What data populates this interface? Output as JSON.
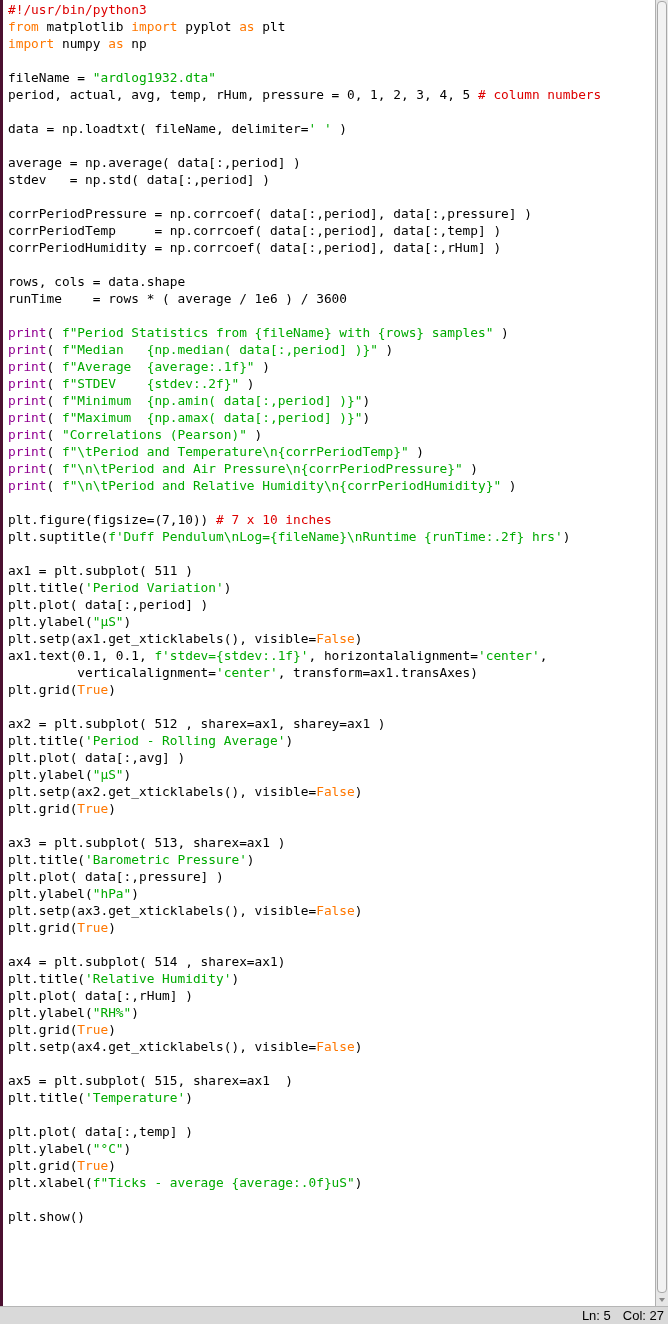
{
  "editor": {
    "lines": [
      {
        "kind": "code",
        "tokens": [
          {
            "kind": "comment",
            "text": "#!/usr/bin/python3"
          }
        ]
      },
      {
        "kind": "code",
        "tokens": [
          {
            "kind": "keyword",
            "text": "from"
          },
          {
            "kind": "plain",
            "text": " matplotlib "
          },
          {
            "kind": "keyword",
            "text": "import"
          },
          {
            "kind": "plain",
            "text": " pyplot "
          },
          {
            "kind": "keyword",
            "text": "as"
          },
          {
            "kind": "plain",
            "text": " plt"
          }
        ]
      },
      {
        "kind": "code",
        "tokens": [
          {
            "kind": "keyword",
            "text": "import"
          },
          {
            "kind": "plain",
            "text": " numpy "
          },
          {
            "kind": "keyword",
            "text": "as"
          },
          {
            "kind": "plain",
            "text": " np"
          }
        ]
      },
      {
        "kind": "blank"
      },
      {
        "kind": "code",
        "tokens": [
          {
            "kind": "plain",
            "text": "fileName = "
          },
          {
            "kind": "string",
            "text": "\"ardlog1932.dta\""
          }
        ]
      },
      {
        "kind": "code",
        "tokens": [
          {
            "kind": "plain",
            "text": "period, actual, avg, temp, rHum, pressure = 0, 1, 2, 3, 4, 5 "
          },
          {
            "kind": "comment",
            "text": "# column numbers"
          }
        ]
      },
      {
        "kind": "blank"
      },
      {
        "kind": "code",
        "tokens": [
          {
            "kind": "plain",
            "text": "data = np.loadtxt( fileName, delimiter="
          },
          {
            "kind": "string",
            "text": "' '"
          },
          {
            "kind": "plain",
            "text": " )"
          }
        ]
      },
      {
        "kind": "blank"
      },
      {
        "kind": "code",
        "tokens": [
          {
            "kind": "plain",
            "text": "average = np.average( data[:,period] )"
          }
        ]
      },
      {
        "kind": "code",
        "tokens": [
          {
            "kind": "plain",
            "text": "stdev   = np.std( data[:,period] )"
          }
        ]
      },
      {
        "kind": "blank"
      },
      {
        "kind": "code",
        "tokens": [
          {
            "kind": "plain",
            "text": "corrPeriodPressure = np.corrcoef( data[:,period], data[:,pressure] )"
          }
        ]
      },
      {
        "kind": "code",
        "tokens": [
          {
            "kind": "plain",
            "text": "corrPeriodTemp     = np.corrcoef( data[:,period], data[:,temp] )"
          }
        ]
      },
      {
        "kind": "code",
        "tokens": [
          {
            "kind": "plain",
            "text": "corrPeriodHumidity = np.corrcoef( data[:,period], data[:,rHum] )"
          }
        ]
      },
      {
        "kind": "blank"
      },
      {
        "kind": "code",
        "tokens": [
          {
            "kind": "plain",
            "text": "rows, cols = data.shape"
          }
        ]
      },
      {
        "kind": "code",
        "tokens": [
          {
            "kind": "plain",
            "text": "runTime    = rows * ( average / 1e6 ) / 3600"
          }
        ]
      },
      {
        "kind": "blank"
      },
      {
        "kind": "code",
        "tokens": [
          {
            "kind": "builtin",
            "text": "print"
          },
          {
            "kind": "plain",
            "text": "( "
          },
          {
            "kind": "string",
            "text": "f\"Period Statistics from {fileName} with {rows} samples\""
          },
          {
            "kind": "plain",
            "text": " )"
          }
        ]
      },
      {
        "kind": "code",
        "tokens": [
          {
            "kind": "builtin",
            "text": "print"
          },
          {
            "kind": "plain",
            "text": "( "
          },
          {
            "kind": "string",
            "text": "f\"Median   {np.median( data[:,period] )}\""
          },
          {
            "kind": "plain",
            "text": " )"
          }
        ]
      },
      {
        "kind": "code",
        "tokens": [
          {
            "kind": "builtin",
            "text": "print"
          },
          {
            "kind": "plain",
            "text": "( "
          },
          {
            "kind": "string",
            "text": "f\"Average  {average:.1f}\""
          },
          {
            "kind": "plain",
            "text": " )"
          }
        ]
      },
      {
        "kind": "code",
        "tokens": [
          {
            "kind": "builtin",
            "text": "print"
          },
          {
            "kind": "plain",
            "text": "( "
          },
          {
            "kind": "string",
            "text": "f\"STDEV    {stdev:.2f}\""
          },
          {
            "kind": "plain",
            "text": " )"
          }
        ]
      },
      {
        "kind": "code",
        "tokens": [
          {
            "kind": "builtin",
            "text": "print"
          },
          {
            "kind": "plain",
            "text": "( "
          },
          {
            "kind": "string",
            "text": "f\"Minimum  {np.amin( data[:,period] )}\""
          },
          {
            "kind": "plain",
            "text": ")"
          }
        ]
      },
      {
        "kind": "code",
        "tokens": [
          {
            "kind": "builtin",
            "text": "print"
          },
          {
            "kind": "plain",
            "text": "( "
          },
          {
            "kind": "string",
            "text": "f\"Maximum  {np.amax( data[:,period] )}\""
          },
          {
            "kind": "plain",
            "text": ")"
          }
        ]
      },
      {
        "kind": "code",
        "tokens": [
          {
            "kind": "builtin",
            "text": "print"
          },
          {
            "kind": "plain",
            "text": "( "
          },
          {
            "kind": "string",
            "text": "\"Correlations (Pearson)\""
          },
          {
            "kind": "plain",
            "text": " )"
          }
        ]
      },
      {
        "kind": "code",
        "tokens": [
          {
            "kind": "builtin",
            "text": "print"
          },
          {
            "kind": "plain",
            "text": "( "
          },
          {
            "kind": "string",
            "text": "f\"\\tPeriod and Temperature\\n{corrPeriodTemp}\""
          },
          {
            "kind": "plain",
            "text": " )"
          }
        ]
      },
      {
        "kind": "code",
        "tokens": [
          {
            "kind": "builtin",
            "text": "print"
          },
          {
            "kind": "plain",
            "text": "( "
          },
          {
            "kind": "string",
            "text": "f\"\\n\\tPeriod and Air Pressure\\n{corrPeriodPressure}\""
          },
          {
            "kind": "plain",
            "text": " )"
          }
        ]
      },
      {
        "kind": "code",
        "tokens": [
          {
            "kind": "builtin",
            "text": "print"
          },
          {
            "kind": "plain",
            "text": "( "
          },
          {
            "kind": "string",
            "text": "f\"\\n\\tPeriod and Relative Humidity\\n{corrPeriodHumidity}\""
          },
          {
            "kind": "plain",
            "text": " )"
          }
        ]
      },
      {
        "kind": "blank"
      },
      {
        "kind": "code",
        "tokens": [
          {
            "kind": "plain",
            "text": "plt.figure(figsize=(7,10)) "
          },
          {
            "kind": "comment",
            "text": "# 7 x 10 inches"
          }
        ]
      },
      {
        "kind": "code",
        "tokens": [
          {
            "kind": "plain",
            "text": "plt.suptitle("
          },
          {
            "kind": "string",
            "text": "f'Duff Pendulum\\nLog={fileName}\\nRuntime {runTime:.2f} hrs'"
          },
          {
            "kind": "plain",
            "text": ")"
          }
        ]
      },
      {
        "kind": "blank"
      },
      {
        "kind": "code",
        "tokens": [
          {
            "kind": "plain",
            "text": "ax1 = plt.subplot( 511 )"
          }
        ]
      },
      {
        "kind": "code",
        "tokens": [
          {
            "kind": "plain",
            "text": "plt.title("
          },
          {
            "kind": "string",
            "text": "'Period Variation'"
          },
          {
            "kind": "plain",
            "text": ")"
          }
        ]
      },
      {
        "kind": "code",
        "tokens": [
          {
            "kind": "plain",
            "text": "plt.plot( data[:,period] )"
          }
        ]
      },
      {
        "kind": "code",
        "tokens": [
          {
            "kind": "plain",
            "text": "plt.ylabel("
          },
          {
            "kind": "string",
            "text": "\"μS\""
          },
          {
            "kind": "plain",
            "text": ")"
          }
        ]
      },
      {
        "kind": "code",
        "tokens": [
          {
            "kind": "plain",
            "text": "plt.setp(ax1.get_xticklabels(), visible="
          },
          {
            "kind": "keyword",
            "text": "False"
          },
          {
            "kind": "plain",
            "text": ")"
          }
        ]
      },
      {
        "kind": "code",
        "tokens": [
          {
            "kind": "plain",
            "text": "ax1.text(0.1, 0.1, "
          },
          {
            "kind": "string",
            "text": "f'stdev={stdev:.1f}'"
          },
          {
            "kind": "plain",
            "text": ", horizontalalignment="
          },
          {
            "kind": "string",
            "text": "'center'"
          },
          {
            "kind": "plain",
            "text": ","
          }
        ]
      },
      {
        "kind": "code",
        "tokens": [
          {
            "kind": "plain",
            "text": "         verticalalignment="
          },
          {
            "kind": "string",
            "text": "'center'"
          },
          {
            "kind": "plain",
            "text": ", transform=ax1.transAxes)"
          }
        ]
      },
      {
        "kind": "code",
        "tokens": [
          {
            "kind": "plain",
            "text": "plt.grid("
          },
          {
            "kind": "keyword",
            "text": "True"
          },
          {
            "kind": "plain",
            "text": ")"
          }
        ]
      },
      {
        "kind": "blank"
      },
      {
        "kind": "code",
        "tokens": [
          {
            "kind": "plain",
            "text": "ax2 = plt.subplot( 512 , sharex=ax1, sharey=ax1 )"
          }
        ]
      },
      {
        "kind": "code",
        "tokens": [
          {
            "kind": "plain",
            "text": "plt.title("
          },
          {
            "kind": "string",
            "text": "'Period - Rolling Average'"
          },
          {
            "kind": "plain",
            "text": ")"
          }
        ]
      },
      {
        "kind": "code",
        "tokens": [
          {
            "kind": "plain",
            "text": "plt.plot( data[:,avg] )"
          }
        ]
      },
      {
        "kind": "code",
        "tokens": [
          {
            "kind": "plain",
            "text": "plt.ylabel("
          },
          {
            "kind": "string",
            "text": "\"μS\""
          },
          {
            "kind": "plain",
            "text": ")"
          }
        ]
      },
      {
        "kind": "code",
        "tokens": [
          {
            "kind": "plain",
            "text": "plt.setp(ax2.get_xticklabels(), visible="
          },
          {
            "kind": "keyword",
            "text": "False"
          },
          {
            "kind": "plain",
            "text": ")"
          }
        ]
      },
      {
        "kind": "code",
        "tokens": [
          {
            "kind": "plain",
            "text": "plt.grid("
          },
          {
            "kind": "keyword",
            "text": "True"
          },
          {
            "kind": "plain",
            "text": ")"
          }
        ]
      },
      {
        "kind": "blank"
      },
      {
        "kind": "code",
        "tokens": [
          {
            "kind": "plain",
            "text": "ax3 = plt.subplot( 513, sharex=ax1 )"
          }
        ]
      },
      {
        "kind": "code",
        "tokens": [
          {
            "kind": "plain",
            "text": "plt.title("
          },
          {
            "kind": "string",
            "text": "'Barometric Pressure'"
          },
          {
            "kind": "plain",
            "text": ")"
          }
        ]
      },
      {
        "kind": "code",
        "tokens": [
          {
            "kind": "plain",
            "text": "plt.plot( data[:,pressure] )"
          }
        ]
      },
      {
        "kind": "code",
        "tokens": [
          {
            "kind": "plain",
            "text": "plt.ylabel("
          },
          {
            "kind": "string",
            "text": "\"hPa\""
          },
          {
            "kind": "plain",
            "text": ")"
          }
        ]
      },
      {
        "kind": "code",
        "tokens": [
          {
            "kind": "plain",
            "text": "plt.setp(ax3.get_xticklabels(), visible="
          },
          {
            "kind": "keyword",
            "text": "False"
          },
          {
            "kind": "plain",
            "text": ")"
          }
        ]
      },
      {
        "kind": "code",
        "tokens": [
          {
            "kind": "plain",
            "text": "plt.grid("
          },
          {
            "kind": "keyword",
            "text": "True"
          },
          {
            "kind": "plain",
            "text": ")"
          }
        ]
      },
      {
        "kind": "blank"
      },
      {
        "kind": "code",
        "tokens": [
          {
            "kind": "plain",
            "text": "ax4 = plt.subplot( 514 , sharex=ax1)"
          }
        ]
      },
      {
        "kind": "code",
        "tokens": [
          {
            "kind": "plain",
            "text": "plt.title("
          },
          {
            "kind": "string",
            "text": "'Relative Humidity'"
          },
          {
            "kind": "plain",
            "text": ")"
          }
        ]
      },
      {
        "kind": "code",
        "tokens": [
          {
            "kind": "plain",
            "text": "plt.plot( data[:,rHum] )"
          }
        ]
      },
      {
        "kind": "code",
        "tokens": [
          {
            "kind": "plain",
            "text": "plt.ylabel("
          },
          {
            "kind": "string",
            "text": "\"RH%\""
          },
          {
            "kind": "plain",
            "text": ")"
          }
        ]
      },
      {
        "kind": "code",
        "tokens": [
          {
            "kind": "plain",
            "text": "plt.grid("
          },
          {
            "kind": "keyword",
            "text": "True"
          },
          {
            "kind": "plain",
            "text": ")"
          }
        ]
      },
      {
        "kind": "code",
        "tokens": [
          {
            "kind": "plain",
            "text": "plt.setp(ax4.get_xticklabels(), visible="
          },
          {
            "kind": "keyword",
            "text": "False"
          },
          {
            "kind": "plain",
            "text": ")"
          }
        ]
      },
      {
        "kind": "blank"
      },
      {
        "kind": "code",
        "tokens": [
          {
            "kind": "plain",
            "text": "ax5 = plt.subplot( 515, sharex=ax1  )"
          }
        ]
      },
      {
        "kind": "code",
        "tokens": [
          {
            "kind": "plain",
            "text": "plt.title("
          },
          {
            "kind": "string",
            "text": "'Temperature'"
          },
          {
            "kind": "plain",
            "text": ")"
          }
        ]
      },
      {
        "kind": "blank"
      },
      {
        "kind": "code",
        "tokens": [
          {
            "kind": "plain",
            "text": "plt.plot( data[:,temp] )"
          }
        ]
      },
      {
        "kind": "code",
        "tokens": [
          {
            "kind": "plain",
            "text": "plt.ylabel("
          },
          {
            "kind": "string",
            "text": "\"°C\""
          },
          {
            "kind": "plain",
            "text": ")"
          }
        ]
      },
      {
        "kind": "code",
        "tokens": [
          {
            "kind": "plain",
            "text": "plt.grid("
          },
          {
            "kind": "keyword",
            "text": "True"
          },
          {
            "kind": "plain",
            "text": ")"
          }
        ]
      },
      {
        "kind": "code",
        "tokens": [
          {
            "kind": "plain",
            "text": "plt.xlabel("
          },
          {
            "kind": "string",
            "text": "f\"Ticks - average {average:.0f}uS\""
          },
          {
            "kind": "plain",
            "text": ")"
          }
        ]
      },
      {
        "kind": "blank"
      },
      {
        "kind": "code",
        "tokens": [
          {
            "kind": "plain",
            "text": "plt.show()"
          }
        ]
      }
    ]
  },
  "status_bar": {
    "line": "Ln: 5",
    "column": "Col: 27"
  }
}
